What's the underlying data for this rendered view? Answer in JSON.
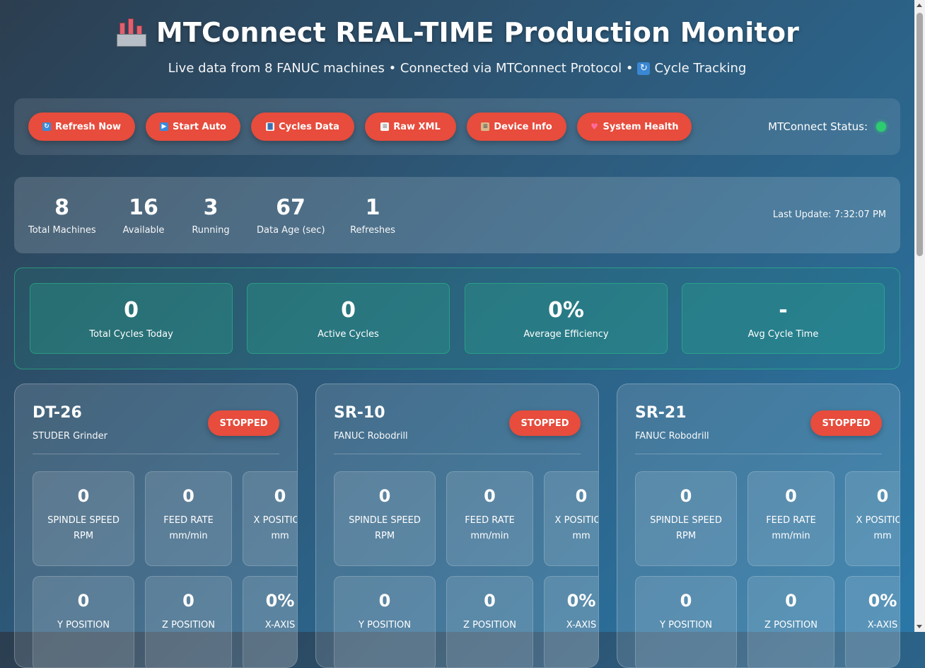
{
  "header": {
    "title": "MTConnect REAL-TIME Production Monitor",
    "subtitle_pre": "Live data from 8 FANUC machines • Connected via MTConnect Protocol •",
    "subtitle_post": "Cycle Tracking"
  },
  "toolbar": {
    "buttons": [
      {
        "label": "Refresh Now",
        "icon": "refresh-icon"
      },
      {
        "label": "Start Auto",
        "icon": "play-icon"
      },
      {
        "label": "Cycles Data",
        "icon": "bar-chart-icon"
      },
      {
        "label": "Raw XML",
        "icon": "document-icon"
      },
      {
        "label": "Device Info",
        "icon": "clipboard-icon"
      },
      {
        "label": "System Health",
        "icon": "heart-icon"
      }
    ],
    "status_label": "MTConnect Status:",
    "status_color": "#2ecc71"
  },
  "stats": {
    "items": [
      {
        "value": "8",
        "label": "Total Machines"
      },
      {
        "value": "16",
        "label": "Available"
      },
      {
        "value": "3",
        "label": "Running"
      },
      {
        "value": "67",
        "label": "Data Age (sec)"
      },
      {
        "value": "1",
        "label": "Refreshes"
      }
    ],
    "last_update": "Last Update: 7:32:07 PM"
  },
  "cycles": [
    {
      "value": "0",
      "label": "Total Cycles Today"
    },
    {
      "value": "0",
      "label": "Active Cycles"
    },
    {
      "value": "0%",
      "label": "Average Efficiency"
    },
    {
      "value": "-",
      "label": "Avg Cycle Time"
    }
  ],
  "machines": [
    {
      "name": "DT-26",
      "type": "STUDER Grinder",
      "status": "STOPPED",
      "metrics": [
        {
          "value": "0",
          "label": "SPINDLE SPEED",
          "unit": "RPM"
        },
        {
          "value": "0",
          "label": "FEED RATE",
          "unit": "mm/min"
        },
        {
          "value": "0",
          "label": "X POSITION",
          "unit": "mm"
        },
        {
          "value": "0",
          "label": "Y POSITION",
          "unit": ""
        },
        {
          "value": "0",
          "label": "Z POSITION",
          "unit": ""
        },
        {
          "value": "0%",
          "label": "X-AXIS",
          "unit": ""
        }
      ]
    },
    {
      "name": "SR-10",
      "type": "FANUC Robodrill",
      "status": "STOPPED",
      "metrics": [
        {
          "value": "0",
          "label": "SPINDLE SPEED",
          "unit": "RPM"
        },
        {
          "value": "0",
          "label": "FEED RATE",
          "unit": "mm/min"
        },
        {
          "value": "0",
          "label": "X POSITION",
          "unit": "mm"
        },
        {
          "value": "0",
          "label": "Y POSITION",
          "unit": ""
        },
        {
          "value": "0",
          "label": "Z POSITION",
          "unit": ""
        },
        {
          "value": "0%",
          "label": "X-AXIS",
          "unit": ""
        }
      ]
    },
    {
      "name": "SR-21",
      "type": "FANUC Robodrill",
      "status": "STOPPED",
      "metrics": [
        {
          "value": "0",
          "label": "SPINDLE SPEED",
          "unit": "RPM"
        },
        {
          "value": "0",
          "label": "FEED RATE",
          "unit": "mm/min"
        },
        {
          "value": "0",
          "label": "X POSITION",
          "unit": "mm"
        },
        {
          "value": "0",
          "label": "Y POSITION",
          "unit": ""
        },
        {
          "value": "0",
          "label": "Z POSITION",
          "unit": ""
        },
        {
          "value": "0%",
          "label": "X-AXIS",
          "unit": ""
        }
      ]
    }
  ]
}
